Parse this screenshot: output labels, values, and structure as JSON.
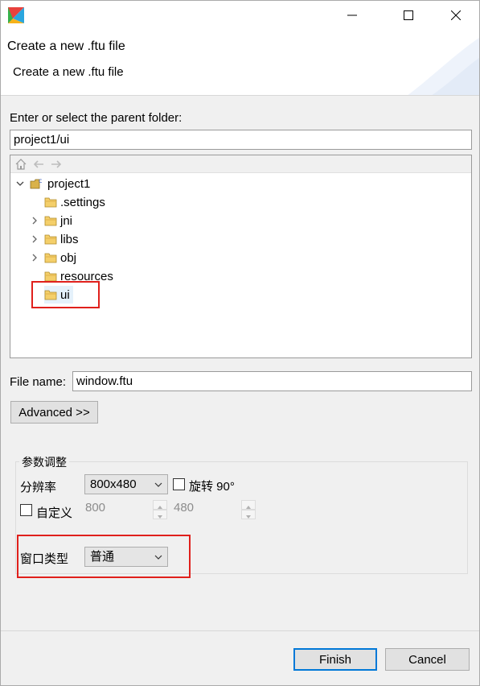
{
  "window": {
    "title": ""
  },
  "banner": {
    "title": "Create a new .ftu file",
    "description": "Create a new .ftu file"
  },
  "parent_folder": {
    "label": "Enter or select the parent folder:",
    "value": "project1/ui"
  },
  "tree": {
    "project": "project1",
    "items": [
      {
        "label": ".settings",
        "expandable": false
      },
      {
        "label": "jni",
        "expandable": true
      },
      {
        "label": "libs",
        "expandable": true
      },
      {
        "label": "obj",
        "expandable": true
      },
      {
        "label": "resources",
        "expandable": false
      },
      {
        "label": "ui",
        "expandable": false,
        "selected": true
      }
    ]
  },
  "file_name": {
    "label": "File name:",
    "value": "window.ftu"
  },
  "advanced_button": "Advanced >>",
  "params": {
    "group_title": "参数调整",
    "resolution_label": "分辨率",
    "resolution_value": "800x480",
    "rotate_label": "旋转 90°",
    "custom_label": "自定义",
    "custom_width": "800",
    "custom_height": "480",
    "window_type_label": "窗口类型",
    "window_type_value": "普通"
  },
  "buttons": {
    "finish": "Finish",
    "cancel": "Cancel"
  },
  "colors": {
    "highlight_red": "#e0201c",
    "primary_border": "#0078d7",
    "selection_bg": "#e5f1fb"
  }
}
